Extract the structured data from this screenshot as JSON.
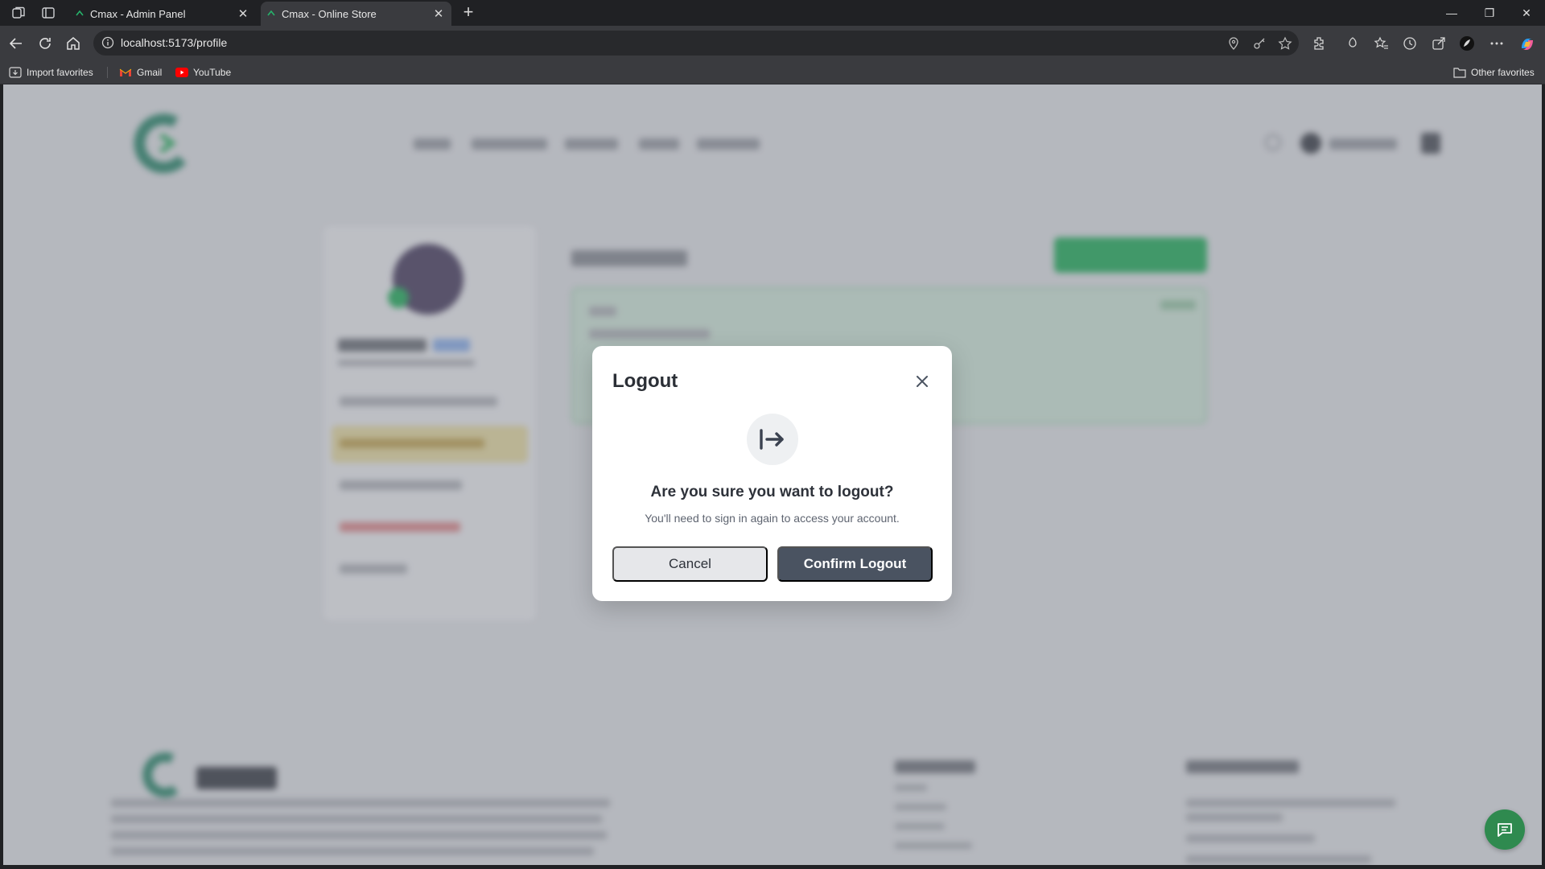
{
  "browser": {
    "tabs": [
      {
        "title": "Cmax - Admin Panel",
        "active": false
      },
      {
        "title": "Cmax - Online Store",
        "active": true
      }
    ],
    "url": "localhost:5173/profile",
    "bookmarks": [
      {
        "label": "Import favorites"
      },
      {
        "label": "Gmail"
      },
      {
        "label": "YouTube"
      }
    ],
    "other_favorites": "Other favorites"
  },
  "modal": {
    "title": "Logout",
    "heading": "Are you sure you want to logout?",
    "subtext": "You'll need to sign in again to access your account.",
    "cancel_label": "Cancel",
    "confirm_label": "Confirm Logout",
    "icon": "logout-arrow-icon"
  },
  "colors": {
    "confirm_button": "#4a5361",
    "cancel_button": "#e6e7ea",
    "chat_button": "#2f8a4f",
    "brand_accent": "#22b35a"
  }
}
